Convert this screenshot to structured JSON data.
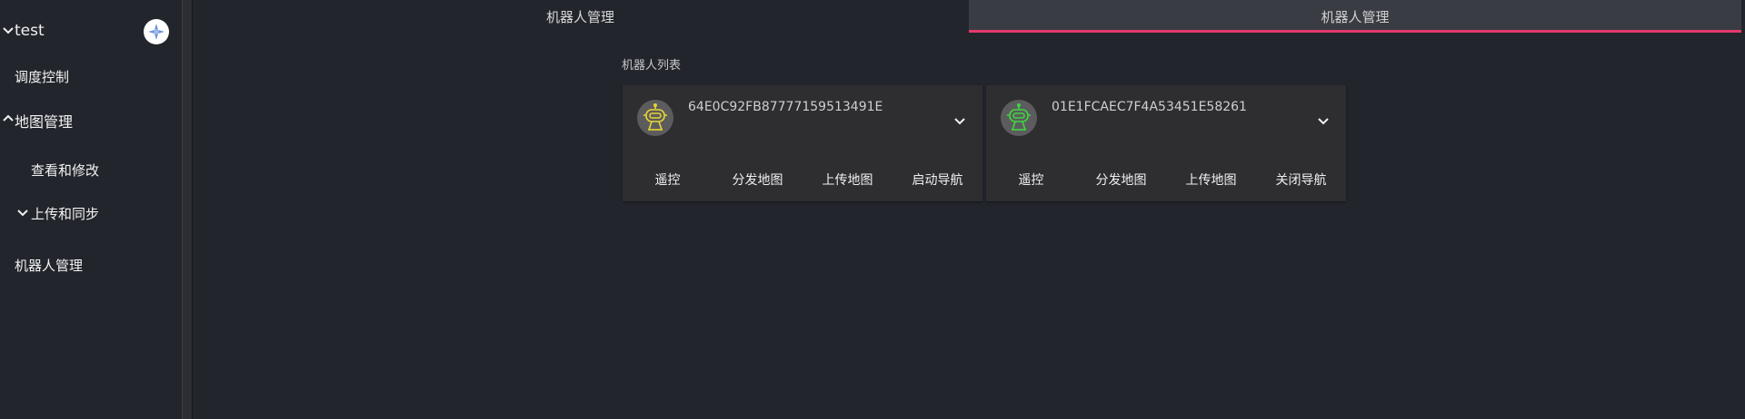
{
  "sidebar": {
    "user_name": "test",
    "items": [
      {
        "label": "调度控制"
      },
      {
        "label": "地图管理"
      },
      {
        "label": "查看和修改"
      },
      {
        "label": "上传和同步"
      },
      {
        "label": "机器人管理"
      }
    ]
  },
  "tabs": [
    {
      "label": "机器人管理",
      "active": false
    },
    {
      "label": "机器人管理",
      "active": true
    }
  ],
  "main": {
    "section_title": "机器人列表",
    "robots": [
      {
        "id": "64E0C92FB87777159513491E",
        "status_color": "#e6d430",
        "actions": [
          "遥控",
          "分发地图",
          "上传地图",
          "启动导航"
        ]
      },
      {
        "id": "01E1FCAEC7F4A53451E58261",
        "status_color": "#3ed63e",
        "actions": [
          "遥控",
          "分发地图",
          "上传地图",
          "关闭导航"
        ]
      }
    ]
  },
  "colors": {
    "accent": "#e6396b",
    "background": "#22252c",
    "card": "#2e2e31"
  }
}
